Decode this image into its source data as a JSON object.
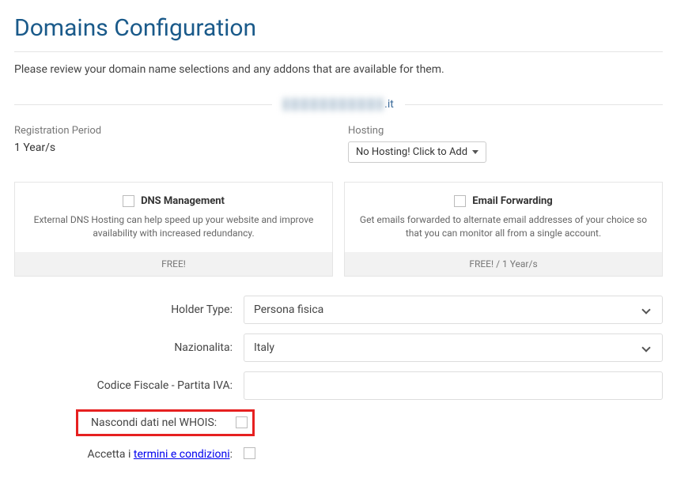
{
  "page": {
    "title": "Domains Configuration",
    "intro": "Please review your domain name selections and any addons that are available for them."
  },
  "domain": {
    "tld": ".it"
  },
  "registration": {
    "label": "Registration Period",
    "value": "1 Year/s"
  },
  "hosting": {
    "label": "Hosting",
    "selected": "No Hosting! Click to Add"
  },
  "addons": [
    {
      "title": "DNS Management",
      "desc": "External DNS Hosting can help speed up your website and improve availability with increased redundancy.",
      "footer": "FREE!"
    },
    {
      "title": "Email Forwarding",
      "desc": "Get emails forwarded to alternate email addresses of your choice so that you can monitor all from a single account.",
      "footer": "FREE! / 1 Year/s"
    }
  ],
  "form": {
    "holder_type": {
      "label": "Holder Type:",
      "value": "Persona fisica"
    },
    "nazionalita": {
      "label": "Nazionalita:",
      "value": "Italy"
    },
    "cf": {
      "label": "Codice Fiscale - Partita IVA:",
      "value": ""
    },
    "whois": {
      "label": "Nascondi dati nel WHOIS:"
    },
    "terms": {
      "prefix": "Accetta i ",
      "link": "termini e condizioni",
      "suffix": ":"
    }
  }
}
